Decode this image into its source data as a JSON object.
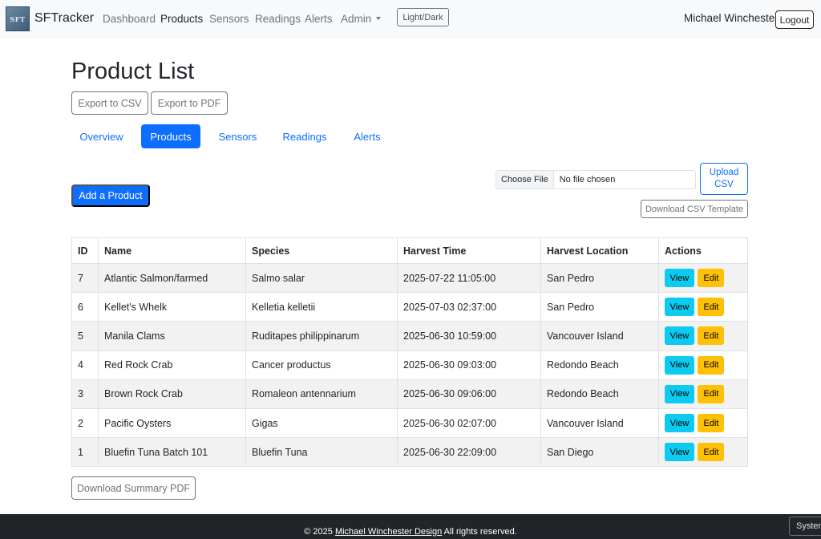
{
  "navbar": {
    "logo_text": "SFT",
    "brand": "SFTracker",
    "links": [
      {
        "label": "Dashboard"
      },
      {
        "label": "Products"
      },
      {
        "label": "Sensors"
      },
      {
        "label": "Readings"
      },
      {
        "label": "Alerts"
      },
      {
        "label": "Admin"
      }
    ],
    "theme_toggle": "Light/Dark",
    "user_name": "Michael Winchester",
    "logout": "Logout"
  },
  "page": {
    "title": "Product List",
    "export_csv": "Export to CSV",
    "export_pdf": "Export to PDF"
  },
  "tabs": [
    {
      "label": "Overview"
    },
    {
      "label": "Products",
      "active": true
    },
    {
      "label": "Sensors"
    },
    {
      "label": "Readings"
    },
    {
      "label": "Alerts"
    }
  ],
  "toolbar": {
    "add_product": "Add a Product",
    "choose_file": "Choose File",
    "file_status": "No file chosen",
    "upload_csv_line1": "Upload",
    "upload_csv_line2": "CSV",
    "download_template": "Download CSV Template"
  },
  "table": {
    "headers": [
      "ID",
      "Name",
      "Species",
      "Harvest Time",
      "Harvest Location",
      "Actions"
    ],
    "rows": [
      {
        "id": "7",
        "name": "Atlantic Salmon/farmed",
        "species": "Salmo salar",
        "harvest_time": "2025-07-22 11:05:00",
        "location": "San Pedro"
      },
      {
        "id": "6",
        "name": "Kellet's Whelk",
        "species": "Kelletia kelletii",
        "harvest_time": "2025-07-03 02:37:00",
        "location": "San Pedro"
      },
      {
        "id": "5",
        "name": "Manila Clams",
        "species": "Ruditapes philippinarum",
        "harvest_time": "2025-06-30 10:59:00",
        "location": "Vancouver Island"
      },
      {
        "id": "4",
        "name": "Red Rock Crab",
        "species": "Cancer productus",
        "harvest_time": "2025-06-30 09:03:00",
        "location": "Redondo Beach"
      },
      {
        "id": "3",
        "name": "Brown Rock Crab",
        "species": "Romaleon antennarium",
        "harvest_time": "2025-06-30 09:06:00",
        "location": "Redondo Beach"
      },
      {
        "id": "2",
        "name": "Pacific Oysters",
        "species": "Gigas",
        "harvest_time": "2025-06-30 02:07:00",
        "location": "Vancouver Island"
      },
      {
        "id": "1",
        "name": "Bluefin Tuna Batch 101",
        "species": "Bluefin Tuna",
        "harvest_time": "2025-06-30 22:09:00",
        "location": "San Diego"
      }
    ],
    "view_label": "View",
    "edit_label": "Edit"
  },
  "summary_pdf": "Download Summary PDF",
  "footer": {
    "prefix": "© 2025",
    "link": "Michael Winchester Design",
    "suffix": "All rights reserved.",
    "theme_select": "System"
  },
  "colors": {
    "primary": "#0d6efd",
    "info": "#0dcaf0",
    "warning": "#ffc107",
    "footer_bg": "#212529",
    "navbar_bg": "#f8f9fa"
  }
}
